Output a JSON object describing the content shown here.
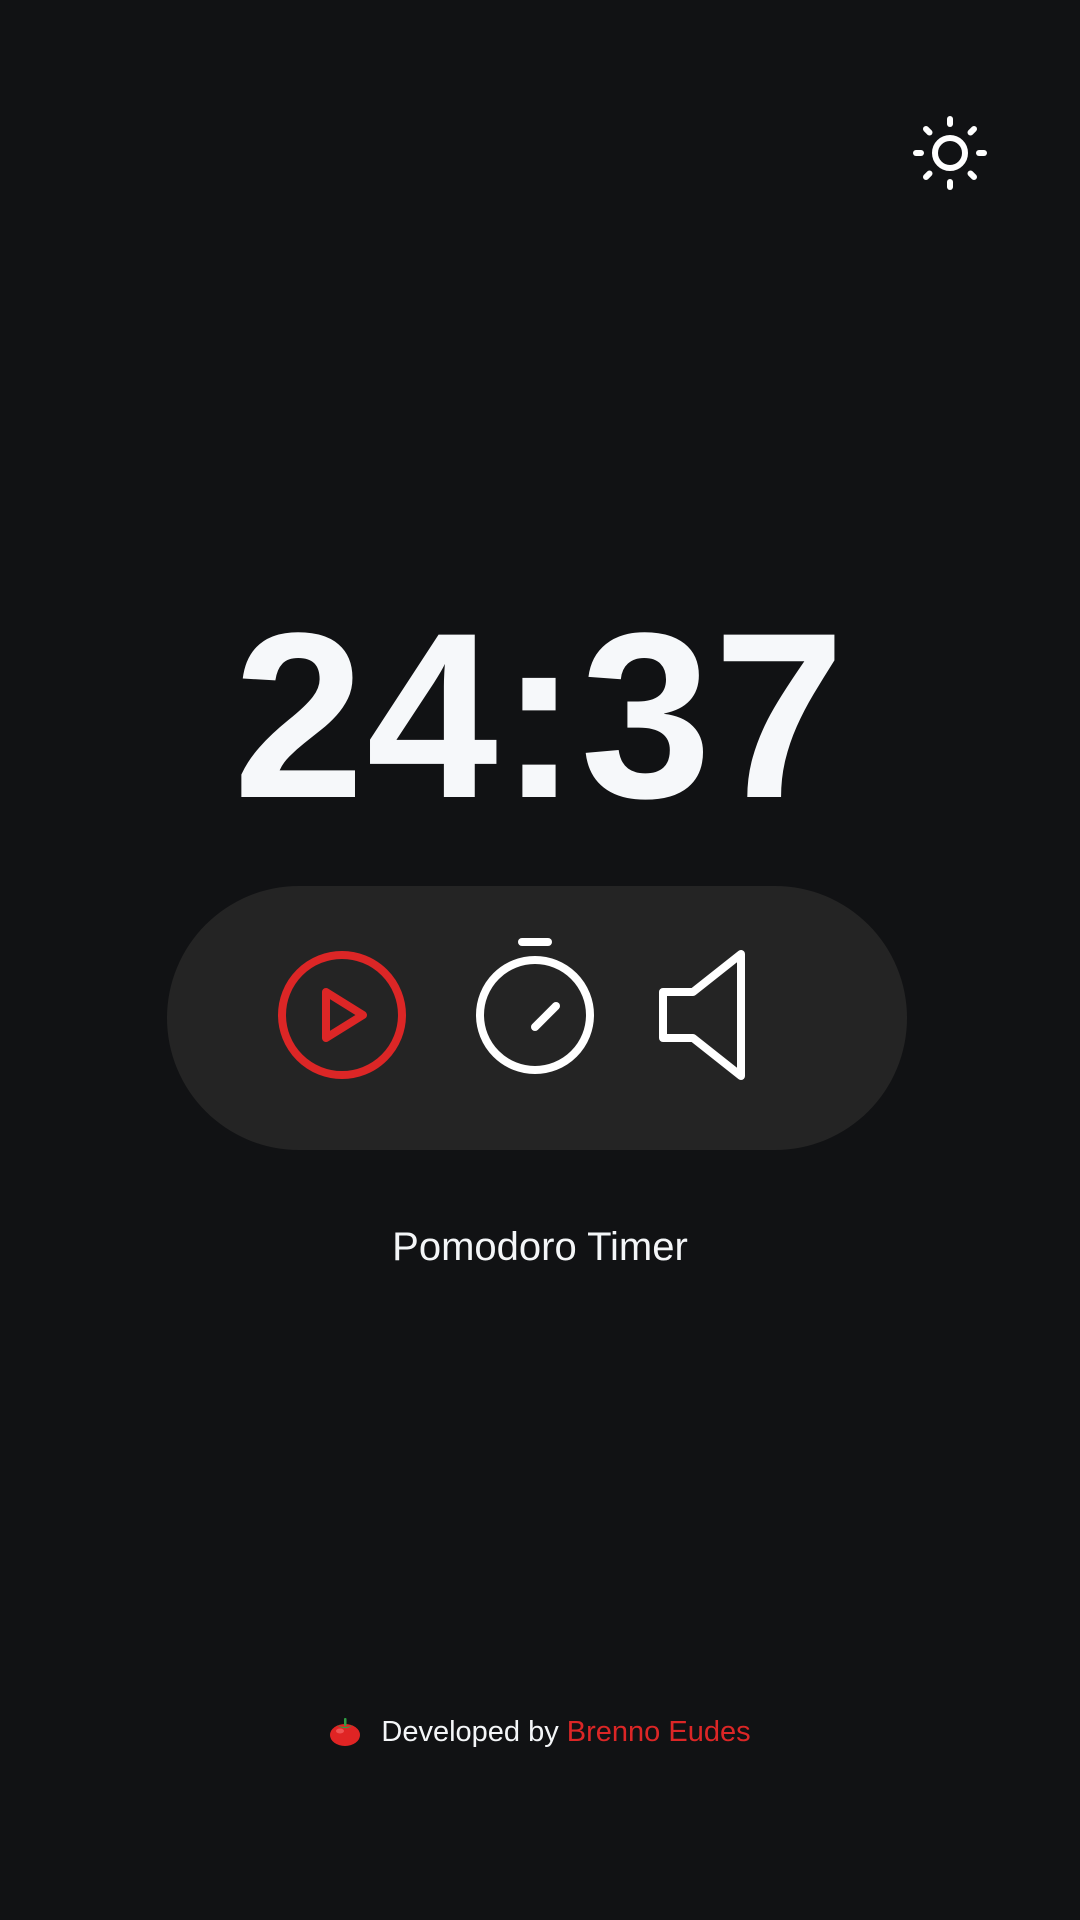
{
  "header": {
    "theme_toggle_icon": "sun-icon"
  },
  "timer": {
    "display": "24:37"
  },
  "controls": {
    "play_icon": "play-circle-icon",
    "mode_icon": "stopwatch-icon",
    "sound_icon": "volume-icon"
  },
  "app": {
    "title": "Pomodoro Timer"
  },
  "footer": {
    "icon": "tomato-icon",
    "prefix": "Developed by",
    "author": "Brenno Eudes"
  },
  "colors": {
    "background": "#111214",
    "panel": "#242424",
    "text": "#f6f8fa",
    "accent": "#dc2626"
  }
}
